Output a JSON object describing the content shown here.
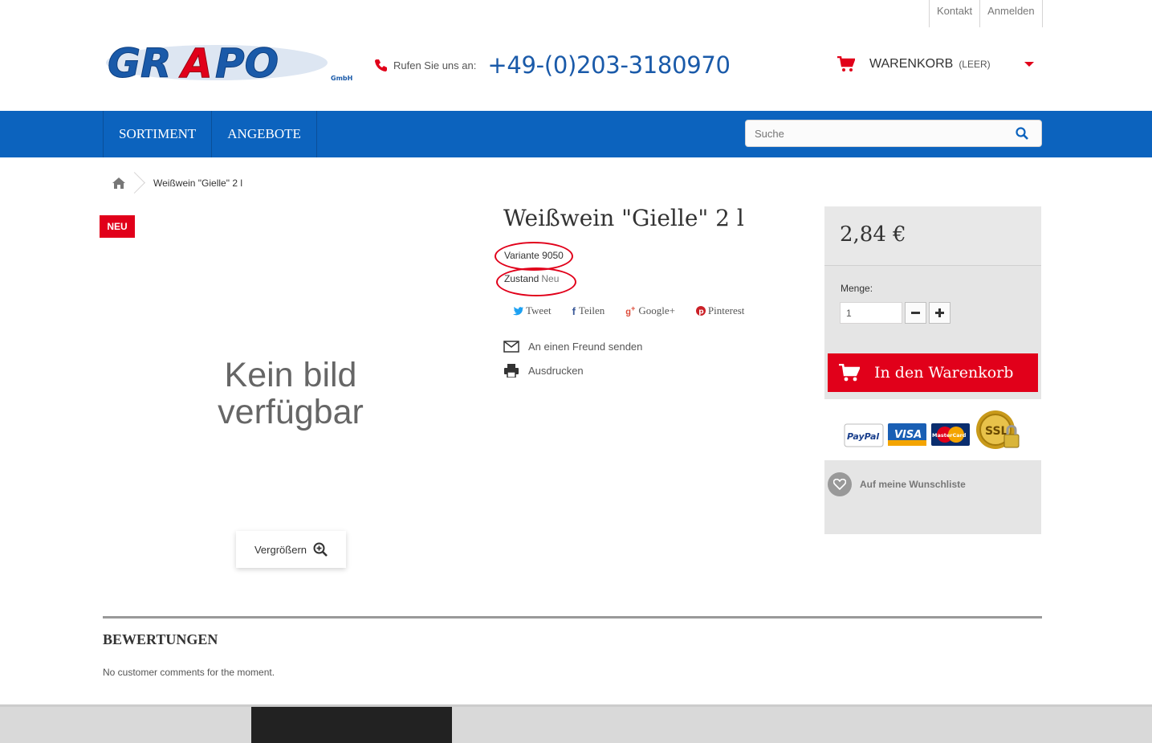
{
  "toplinks": {
    "contact": "Kontakt",
    "login": "Anmelden"
  },
  "header": {
    "logo_text": "GRAPO",
    "logo_sub": "GmbH",
    "call_label": "Rufen Sie uns an:",
    "phone": "+49-(0)203-3180970",
    "cart_label": "WARENKORB",
    "cart_status": "(LEER)"
  },
  "nav": {
    "items": [
      "SORTIMENT",
      "ANGEBOTE"
    ],
    "search_placeholder": "Suche"
  },
  "breadcrumb": {
    "current": "Weißwein \"Gielle\" 2 l"
  },
  "product": {
    "badge": "NEU",
    "no_image": "Kein bild verfügbar",
    "zoom_label": "Vergrößern",
    "title": "Weißwein \"Gielle\" 2 l",
    "reference_label": "Variante",
    "reference_value": "9050",
    "condition_label": "Zustand",
    "condition_value": "Neu",
    "social": [
      "Tweet",
      "Teilen",
      "Google+",
      "Pinterest"
    ],
    "send_friend": "An einen Freund senden",
    "print": "Ausdrucken"
  },
  "buybox": {
    "price": "2,84 €",
    "quantity_label": "Menge:",
    "quantity_value": "1",
    "add_to_cart": "In den Warenkorb",
    "payments": [
      "PayPal",
      "VISA",
      "MasterCard",
      "SSL"
    ],
    "wishlist": "Auf meine Wunschliste"
  },
  "reviews": {
    "title": "BEWERTUNGEN",
    "empty": "No customer comments for the moment."
  },
  "colors": {
    "brand_blue": "#0c63be",
    "accent_red": "#e1001a"
  }
}
